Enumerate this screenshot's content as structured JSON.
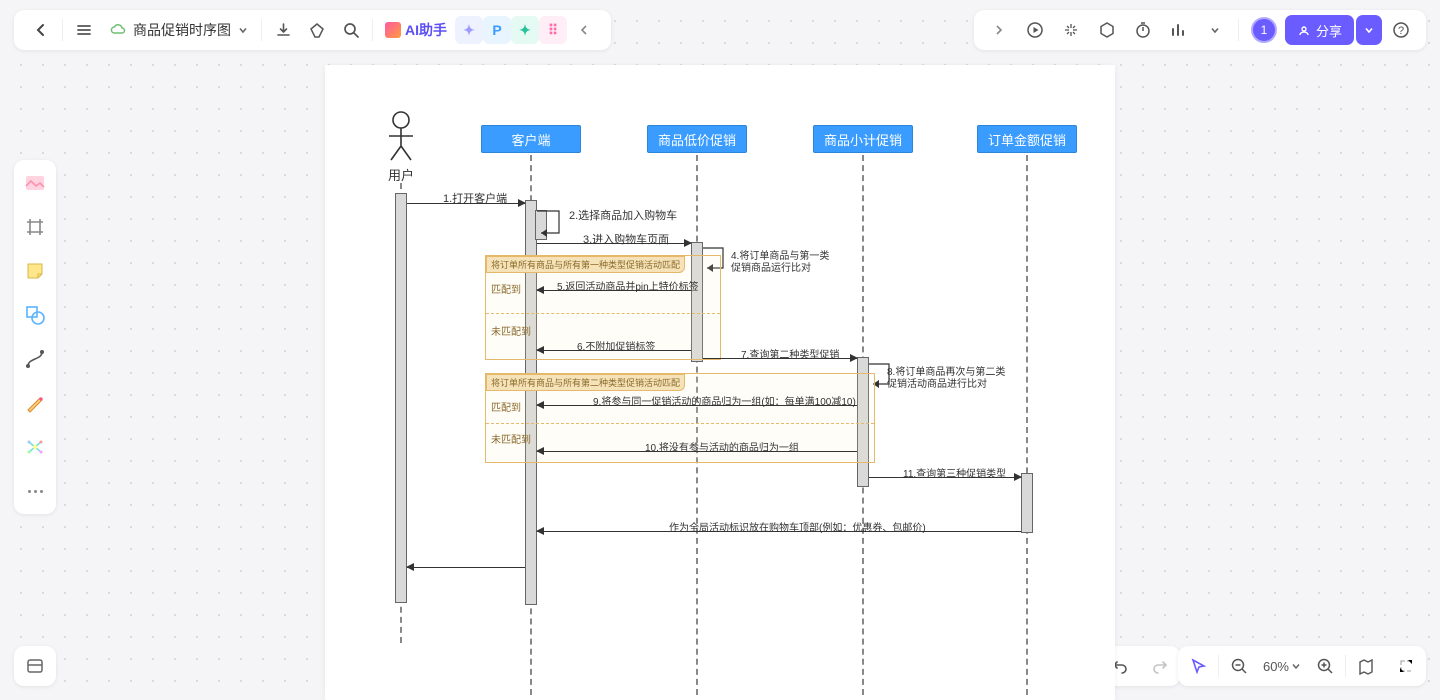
{
  "header": {
    "doc_title": "商品促销时序图",
    "ai_label": "AI助手"
  },
  "share": {
    "label": "分享"
  },
  "avatar": {
    "initial": "1"
  },
  "zoom": {
    "value": "60%"
  },
  "diagram": {
    "actor_label": "用户",
    "lanes": {
      "client": "客户端",
      "low_price": "商品低价促销",
      "subtotal": "商品小计促销",
      "order_amount": "订单金额促销"
    },
    "messages": {
      "m1": "1.打开客户端",
      "m2": "2.选择商品加入购物车",
      "m3": "3.进入购物车页面",
      "m4a": "4.将订单商品与第一类",
      "m4b": "促销商品运行比对",
      "m5": "5.返回活动商品并pin上特价标签",
      "m6": "6.不附加促销标签",
      "m7": "7.查询第二种类型促销",
      "m8a": "8.将订单商品再次与第二类",
      "m8b": "促销活动商品进行比对",
      "m9": "9.将参与同一促销活动的商品归为一组(如：每单满100减10)",
      "m10": "10.将没有参与活动的商品归为一组",
      "m11": "11.查询第三种促销类型",
      "m12": "作为全局活动标识放在购物车顶部(例如：优惠券、包邮价)"
    },
    "alt1": {
      "title": "将订单所有商品与所有第一种类型促销活动匹配",
      "match": "匹配到",
      "nomatch": "未匹配到"
    },
    "alt2": {
      "title": "将订单所有商品与所有第二种类型促销活动匹配",
      "match": "匹配到",
      "nomatch": "未匹配到"
    }
  }
}
